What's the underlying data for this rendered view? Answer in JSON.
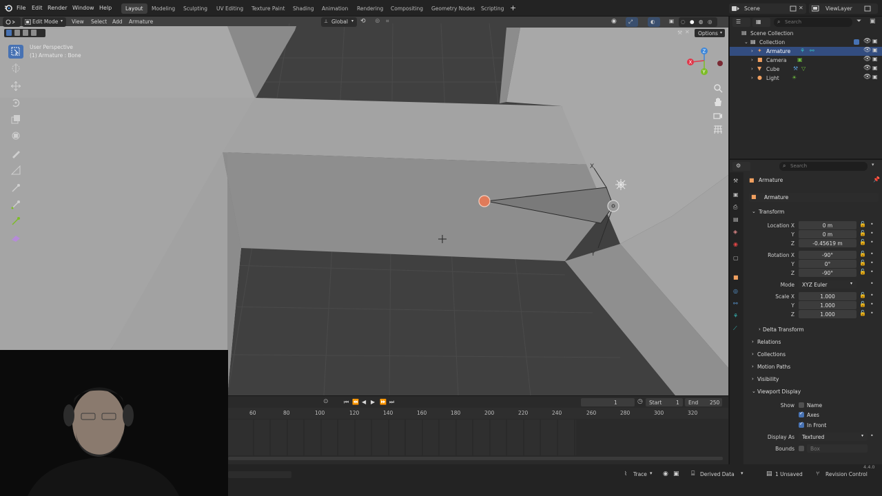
{
  "topbar": {
    "menus": [
      "File",
      "Edit",
      "Render",
      "Window",
      "Help"
    ],
    "workspaces": [
      "Layout",
      "Modeling",
      "Sculpting",
      "UV Editing",
      "Texture Paint",
      "Shading",
      "Animation",
      "Rendering",
      "Compositing",
      "Geometry Nodes",
      "Scripting"
    ],
    "active_workspace": "Layout",
    "add_workspace": "+",
    "scene": "Scene",
    "view_layer": "ViewLayer"
  },
  "viewport": {
    "mode": "Edit Mode",
    "menus": [
      "View",
      "Select",
      "Add",
      "Armature"
    ],
    "transform_orientation": "Global",
    "options_label": "Options",
    "overlay_title": "User Perspective",
    "overlay_subtitle": "(1) Armature : Bone",
    "gizmo_axes": [
      "X",
      "Y",
      "Z"
    ],
    "bone_axis_x": "X",
    "bone_axis_y": "Y"
  },
  "timeline": {
    "current_frame": "1",
    "start_label": "Start",
    "start": "1",
    "end_label": "End",
    "end": "250",
    "ticks": [
      "60",
      "80",
      "100",
      "120",
      "140",
      "160",
      "180",
      "200",
      "220",
      "240",
      "260",
      "280",
      "300",
      "320"
    ]
  },
  "statusbar": {
    "trace": "Trace",
    "derived": "Derived Data",
    "unsaved": "1 Unsaved",
    "revision": "Revision Control",
    "version": "4.4.0"
  },
  "outliner": {
    "search_placeholder": "Search",
    "root": "Scene Collection",
    "collection": "Collection",
    "items": [
      {
        "name": "Armature",
        "selected": true
      },
      {
        "name": "Camera",
        "selected": false
      },
      {
        "name": "Cube",
        "selected": false
      },
      {
        "name": "Light",
        "selected": false
      }
    ]
  },
  "properties": {
    "search_placeholder": "Search",
    "breadcrumb": "Armature",
    "object_name": "Armature",
    "transform": {
      "title": "Transform",
      "location_label": "Location X",
      "location": [
        "0 m",
        "0 m",
        "-0.45619 m"
      ],
      "rotation_label": "Rotation X",
      "rotation": [
        "-90°",
        "0°",
        "-90°"
      ],
      "mode_label": "Mode",
      "mode": "XYZ Euler",
      "scale_label": "Scale X",
      "scale": [
        "1.000",
        "1.000",
        "1.000"
      ],
      "axis_y": "Y",
      "axis_z": "Z"
    },
    "delta_transform": "Delta Transform",
    "sections": [
      "Relations",
      "Collections",
      "Motion Paths",
      "Visibility"
    ],
    "viewport_display": {
      "title": "Viewport Display",
      "show_label": "Show",
      "name_label": "Name",
      "axes_label": "Axes",
      "in_front_label": "In Front",
      "display_as_label": "Display As",
      "display_as": "Textured",
      "bounds_label": "Bounds",
      "bounds": "Box"
    }
  },
  "colors": {
    "accent": "#4772b3",
    "selected_bone": "#e07b5a",
    "x_axis": "#e0374a",
    "y_axis": "#7dbc27",
    "z_axis": "#3c86d8"
  }
}
